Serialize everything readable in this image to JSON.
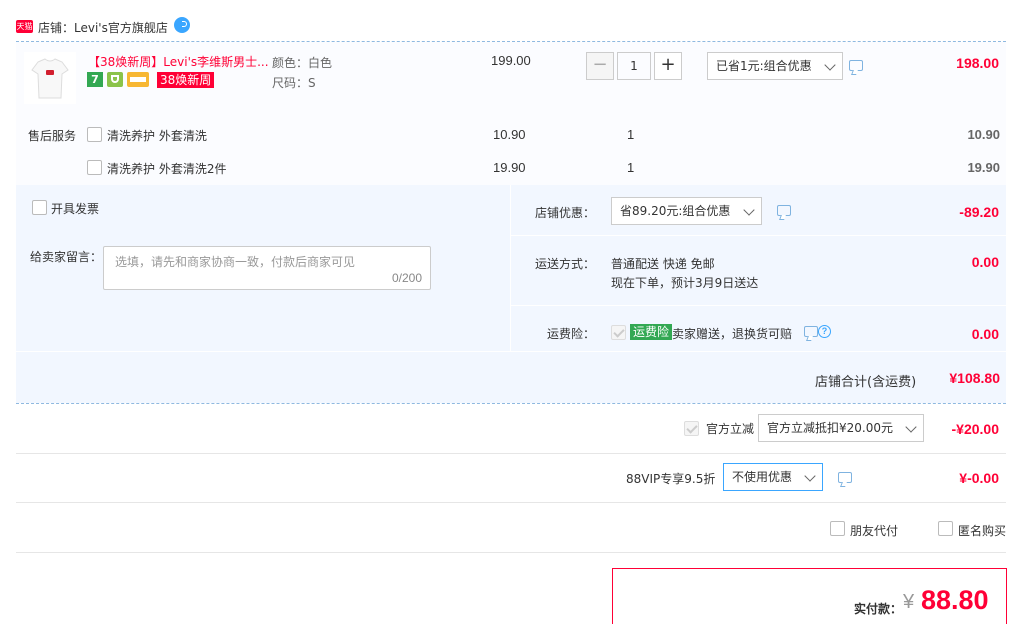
{
  "shop": {
    "badge": "天猫",
    "name_label": "店铺：Levi's官方旗舰店"
  },
  "item": {
    "title": "【38焕新周】Levi's李维斯男士...",
    "promo_badge": "38焕新周",
    "badge_seven": "7",
    "color_label": "颜色：白色",
    "size_label": "尺码：S",
    "unit_price": "199.00",
    "quantity": "1",
    "discount_select": "已省1元:组合优惠",
    "total": "198.00",
    "logo_text": "Levi's"
  },
  "services": {
    "label": "售后服务",
    "rows": [
      {
        "name": "清洗养护 外套清洗",
        "price": "10.90",
        "qty": "1",
        "total": "10.90"
      },
      {
        "name": "清洗养护 外套清洗2件",
        "price": "19.90",
        "qty": "1",
        "total": "19.90"
      }
    ]
  },
  "left_panel": {
    "invoice_label": "开具发票",
    "message_label": "给卖家留言：",
    "message_placeholder": "选填，请先和商家协商一致，付款后商家可见",
    "message_counter": "0/200"
  },
  "right_panel": {
    "shop_discount_label": "店铺优惠：",
    "shop_discount_select": "省89.20元:组合优惠",
    "shop_discount_value": "-89.20",
    "shipping_label": "运送方式：",
    "shipping_line1": "普通配送 快递 免邮",
    "shipping_line2": "现在下单，预计3月9日送达",
    "shipping_value": "0.00",
    "insurance_label": "运费险：",
    "insurance_badge": "运费险",
    "insurance_text": "卖家赠送，退换货可赔",
    "insurance_value": "0.00"
  },
  "shop_total": {
    "label": "店铺合计(含运费)",
    "value": "¥108.80"
  },
  "official": {
    "label": "官方立减",
    "select": "官方立减抵扣¥20.00元",
    "value": "-¥20.00"
  },
  "vip": {
    "label": "88VIP专享9.5折",
    "select": "不使用优惠",
    "value": "¥-0.00"
  },
  "options": {
    "friend_pay": "朋友代付",
    "anonymous": "匿名购买"
  },
  "payment": {
    "label": "实付款：",
    "currency": "¥",
    "amount": "88.80"
  },
  "colors": {
    "accent_red": "#ff0036",
    "panel_blue": "#f2f7ff",
    "border_blue": "#b2d1ff",
    "tmall_red": "#ff0036",
    "insurance_green": "#33a853"
  }
}
